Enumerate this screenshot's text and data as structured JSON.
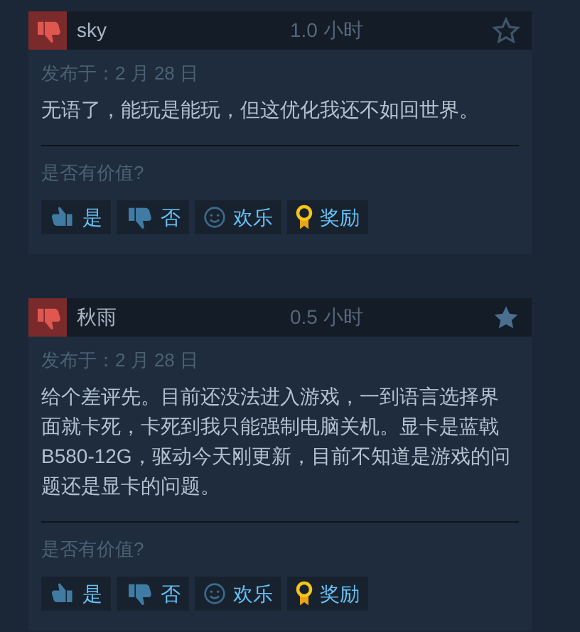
{
  "reviews": [
    {
      "author": "sky",
      "playtime": "1.0 小时",
      "starred": false,
      "posted": "发布于：2 月 28 日",
      "text": "无语了，能玩是能玩，但这优化我还不如回世界。",
      "helpful_prompt": "是否有价值?",
      "actions": [
        {
          "kind": "yes",
          "label": "是"
        },
        {
          "kind": "no",
          "label": "否"
        },
        {
          "kind": "funny",
          "label": "欢乐"
        },
        {
          "kind": "award",
          "label": "奖励"
        }
      ]
    },
    {
      "author": "秋雨",
      "playtime": "0.5 小时",
      "starred": true,
      "posted": "发布于：2 月 28 日",
      "text": "给个差评先。目前还没法进入游戏，一到语言选择界面就卡死，卡死到我只能强制电脑关机。显卡是蓝戟B580-12G，驱动今天刚更新，目前不知道是游戏的问题还是显卡的问题。",
      "helpful_prompt": "是否有价值?",
      "actions": [
        {
          "kind": "yes",
          "label": "是"
        },
        {
          "kind": "no",
          "label": "否"
        },
        {
          "kind": "funny",
          "label": "欢乐"
        },
        {
          "kind": "award",
          "label": "奖励"
        }
      ]
    }
  ]
}
